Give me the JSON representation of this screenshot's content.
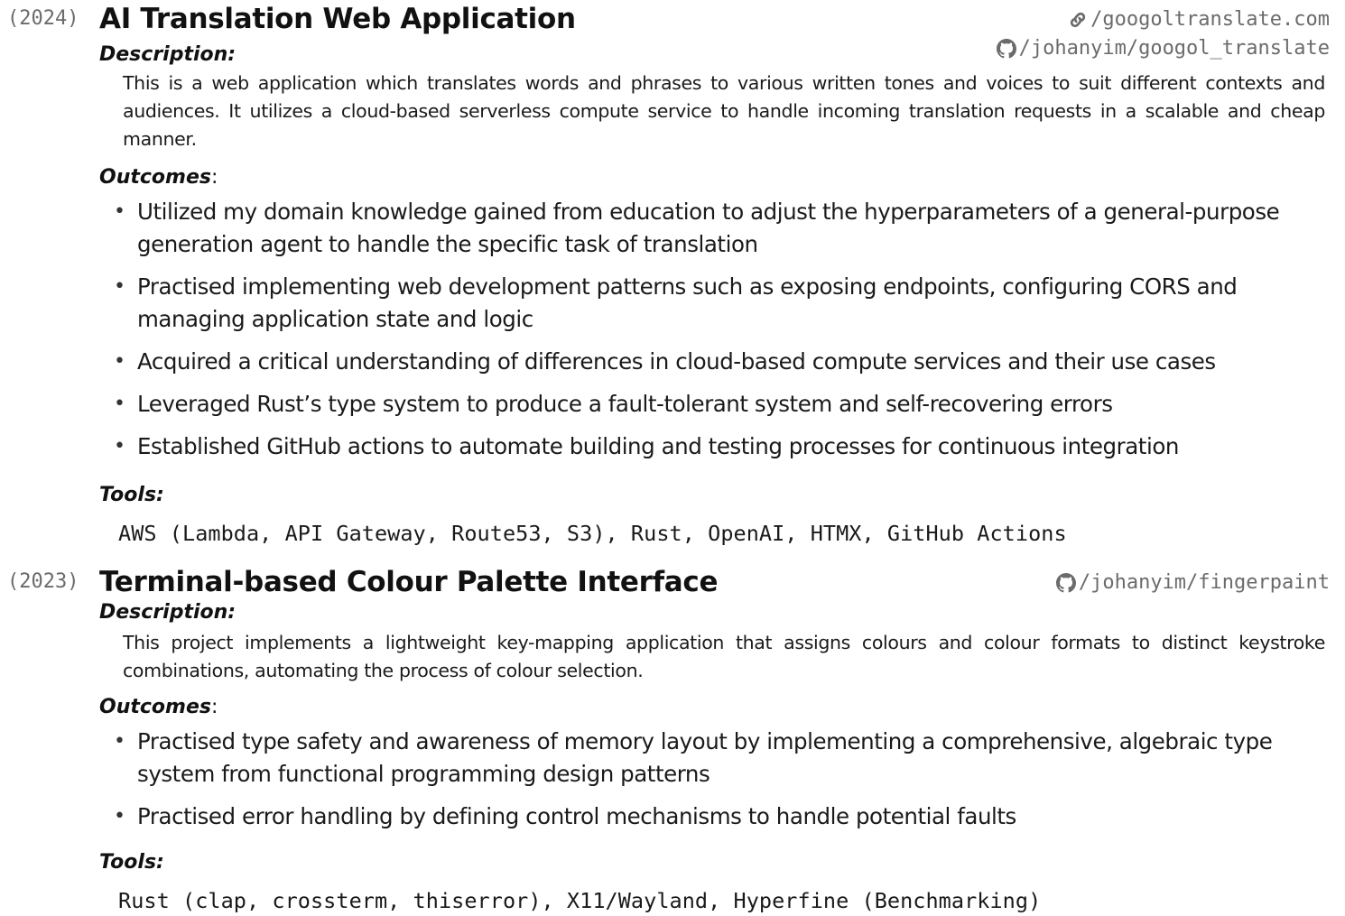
{
  "projects": [
    {
      "year": "(2024)",
      "title": "AI Translation Web Application",
      "links": [
        {
          "icon": "link-icon",
          "text": "/googoltranslate.com"
        },
        {
          "icon": "github-icon",
          "text": "/johanyim/googol_translate"
        }
      ],
      "description_label": "Description:",
      "description": "This is a web application which translates words and phrases to various written tones and voices to suit different contexts and audiences. It utilizes a cloud-based serverless compute service to handle incoming translation requests in a scalable and cheap manner.",
      "outcomes_label": "Outcomes",
      "outcomes_colon": ":",
      "outcomes": [
        "Utilized my domain knowledge gained from education to adjust the hyperparameters of a general-purpose generation agent to handle the specific task of translation",
        "Practised implementing web development patterns such as exposing endpoints, configuring CORS and managing application state and logic",
        "Acquired a critical understanding of differences in cloud-based compute services and their use cases",
        "Leveraged Rust’s type system to produce a fault-tolerant system and self-recovering errors",
        "Established GitHub actions to automate building and testing processes for continuous integration"
      ],
      "tools_label": "Tools:",
      "tools": "AWS (Lambda, API Gateway, Route53, S3), Rust, OpenAI, HTMX, GitHub Actions"
    },
    {
      "year": "(2023)",
      "title": "Terminal-based Colour Palette Interface",
      "links": [
        {
          "icon": "github-icon",
          "text": "/johanyim/fingerpaint"
        }
      ],
      "description_label": "Description:",
      "description": "This project implements a lightweight key-mapping application that assigns colours and colour formats to distinct keystroke combinations, automating the process of colour selection.",
      "outcomes_label": "Outcomes",
      "outcomes_colon": ":",
      "outcomes": [
        "Practised type safety and awareness of memory layout by implementing a comprehensive, algebraic type system from functional programming design patterns",
        "Practised error handling by defining control mechanisms to handle potential faults"
      ],
      "tools_label": "Tools:",
      "tools": "Rust (clap, crossterm, thiserror), X11/Wayland, Hyperfine (Benchmarking)"
    }
  ],
  "bullet_glyph": "•",
  "colors": {
    "text": "#1a1a1a",
    "muted": "#6b6b6b"
  }
}
